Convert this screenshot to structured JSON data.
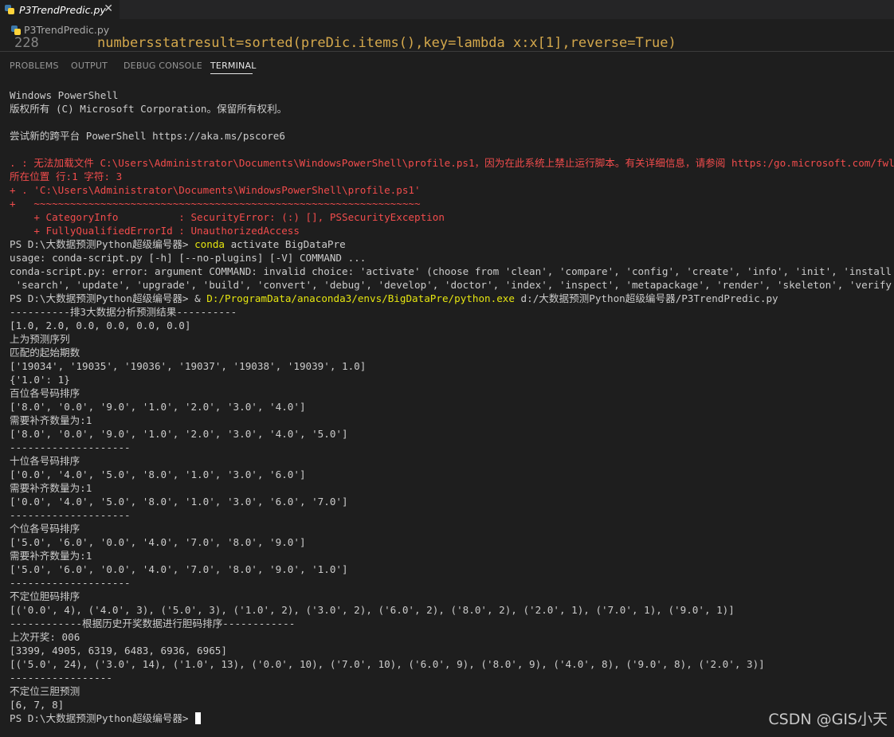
{
  "tab": {
    "label": "P3TrendPredic.py",
    "close": "✕"
  },
  "breadcrumb": {
    "file": "P3TrendPredic.py"
  },
  "editor": {
    "line_number": "228",
    "code": "numbersstatresult=sorted(preDic.items(),key=lambda x:x[1],reverse=True)"
  },
  "panel": {
    "tabs": [
      "PROBLEMS",
      "OUTPUT",
      "DEBUG CONSOLE",
      "TERMINAL"
    ],
    "active_tab": "TERMINAL"
  },
  "terminal": {
    "l1": "Windows PowerShell",
    "l2": "版权所有 (C) Microsoft Corporation。保留所有权利。",
    "l3": "",
    "l4": "尝试新的跨平台 PowerShell https://aka.ms/pscore6",
    "l5": "",
    "l6": ". : 无法加载文件 C:\\Users\\Administrator\\Documents\\WindowsPowerShell\\profile.ps1，因为在此系统上禁止运行脚本。有关详细信息，请参阅 https:/go.microsoft.com/fwlink",
    "l7": "所在位置 行:1 字符: 3",
    "l8": "+ . 'C:\\Users\\Administrator\\Documents\\WindowsPowerShell\\profile.ps1'",
    "l9": "+   ~~~~~~~~~~~~~~~~~~~~~~~~~~~~~~~~~~~~~~~~~~~~~~~~~~~~~~~~~~~~~~~~",
    "l10": "    + CategoryInfo          : SecurityError: (:) [], PSSecurityException",
    "l11": "    + FullyQualifiedErrorId : UnauthorizedAccess",
    "l12_prompt": "PS D:\\大数据预测Python超级编号器> ",
    "l12_cmd": "conda",
    "l12_args": " activate BigDataPre",
    "l13": "usage: conda-script.py [-h] [--no-plugins] [-V] COMMAND ...",
    "l14": "conda-script.py: error: argument COMMAND: invalid choice: 'activate' (choose from 'clean', 'compare', 'config', 'create', 'info', 'init', 'install', 'list', 'r",
    "l15": " 'search', 'update', 'upgrade', 'build', 'convert', 'debug', 'develop', 'doctor', 'index', 'inspect', 'metapackage', 'render', 'skeleton', 'verify', 'token', '",
    "l16_prompt": "PS D:\\大数据预测Python超级编号器> & ",
    "l16_cmd": "D:/ProgramData/anaconda3/envs/BigDataPre/python.exe",
    "l16_args": " d:/大数据预测Python超级编号器/P3TrendPredic.py",
    "l17": "----------排3大数据分析预测结果----------",
    "l18": "[1.0, 2.0, 0.0, 0.0, 0.0, 0.0]",
    "l19": "上为预测序列",
    "l20": "匹配的起始期数",
    "l21": "['19034', '19035', '19036', '19037', '19038', '19039', 1.0]",
    "l22": "{'1.0': 1}",
    "l23": "百位各号码排序",
    "l24": "['8.0', '0.0', '9.0', '1.0', '2.0', '3.0', '4.0']",
    "l25": "需要补齐数量为:1",
    "l26": "['8.0', '0.0', '9.0', '1.0', '2.0', '3.0', '4.0', '5.0']",
    "l27": "--------------------",
    "l28": "十位各号码排序",
    "l29": "['0.0', '4.0', '5.0', '8.0', '1.0', '3.0', '6.0']",
    "l30": "需要补齐数量为:1",
    "l31": "['0.0', '4.0', '5.0', '8.0', '1.0', '3.0', '6.0', '7.0']",
    "l32": "--------------------",
    "l33": "个位各号码排序",
    "l34": "['5.0', '6.0', '0.0', '4.0', '7.0', '8.0', '9.0']",
    "l35": "需要补齐数量为:1",
    "l36": "['5.0', '6.0', '0.0', '4.0', '7.0', '8.0', '9.0', '1.0']",
    "l37": "--------------------",
    "l38": "不定位胆码排序",
    "l39": "[('0.0', 4), ('4.0', 3), ('5.0', 3), ('1.0', 2), ('3.0', 2), ('6.0', 2), ('8.0', 2), ('2.0', 1), ('7.0', 1), ('9.0', 1)]",
    "l40": "------------根据历史开奖数据进行胆码排序------------",
    "l41": "上次开奖: 006",
    "l42": "[3399, 4905, 6319, 6483, 6936, 6965]",
    "l43": "[('5.0', 24), ('3.0', 14), ('1.0', 13), ('0.0', 10), ('7.0', 10), ('6.0', 9), ('8.0', 9), ('4.0', 8), ('9.0', 8), ('2.0', 3)]",
    "l44": "-----------------",
    "l45": "不定位三胆预测",
    "l46": "[6, 7, 8]",
    "l47_prompt": "PS D:\\大数据预测Python超级编号器> "
  },
  "watermark": "CSDN @GIS小天"
}
